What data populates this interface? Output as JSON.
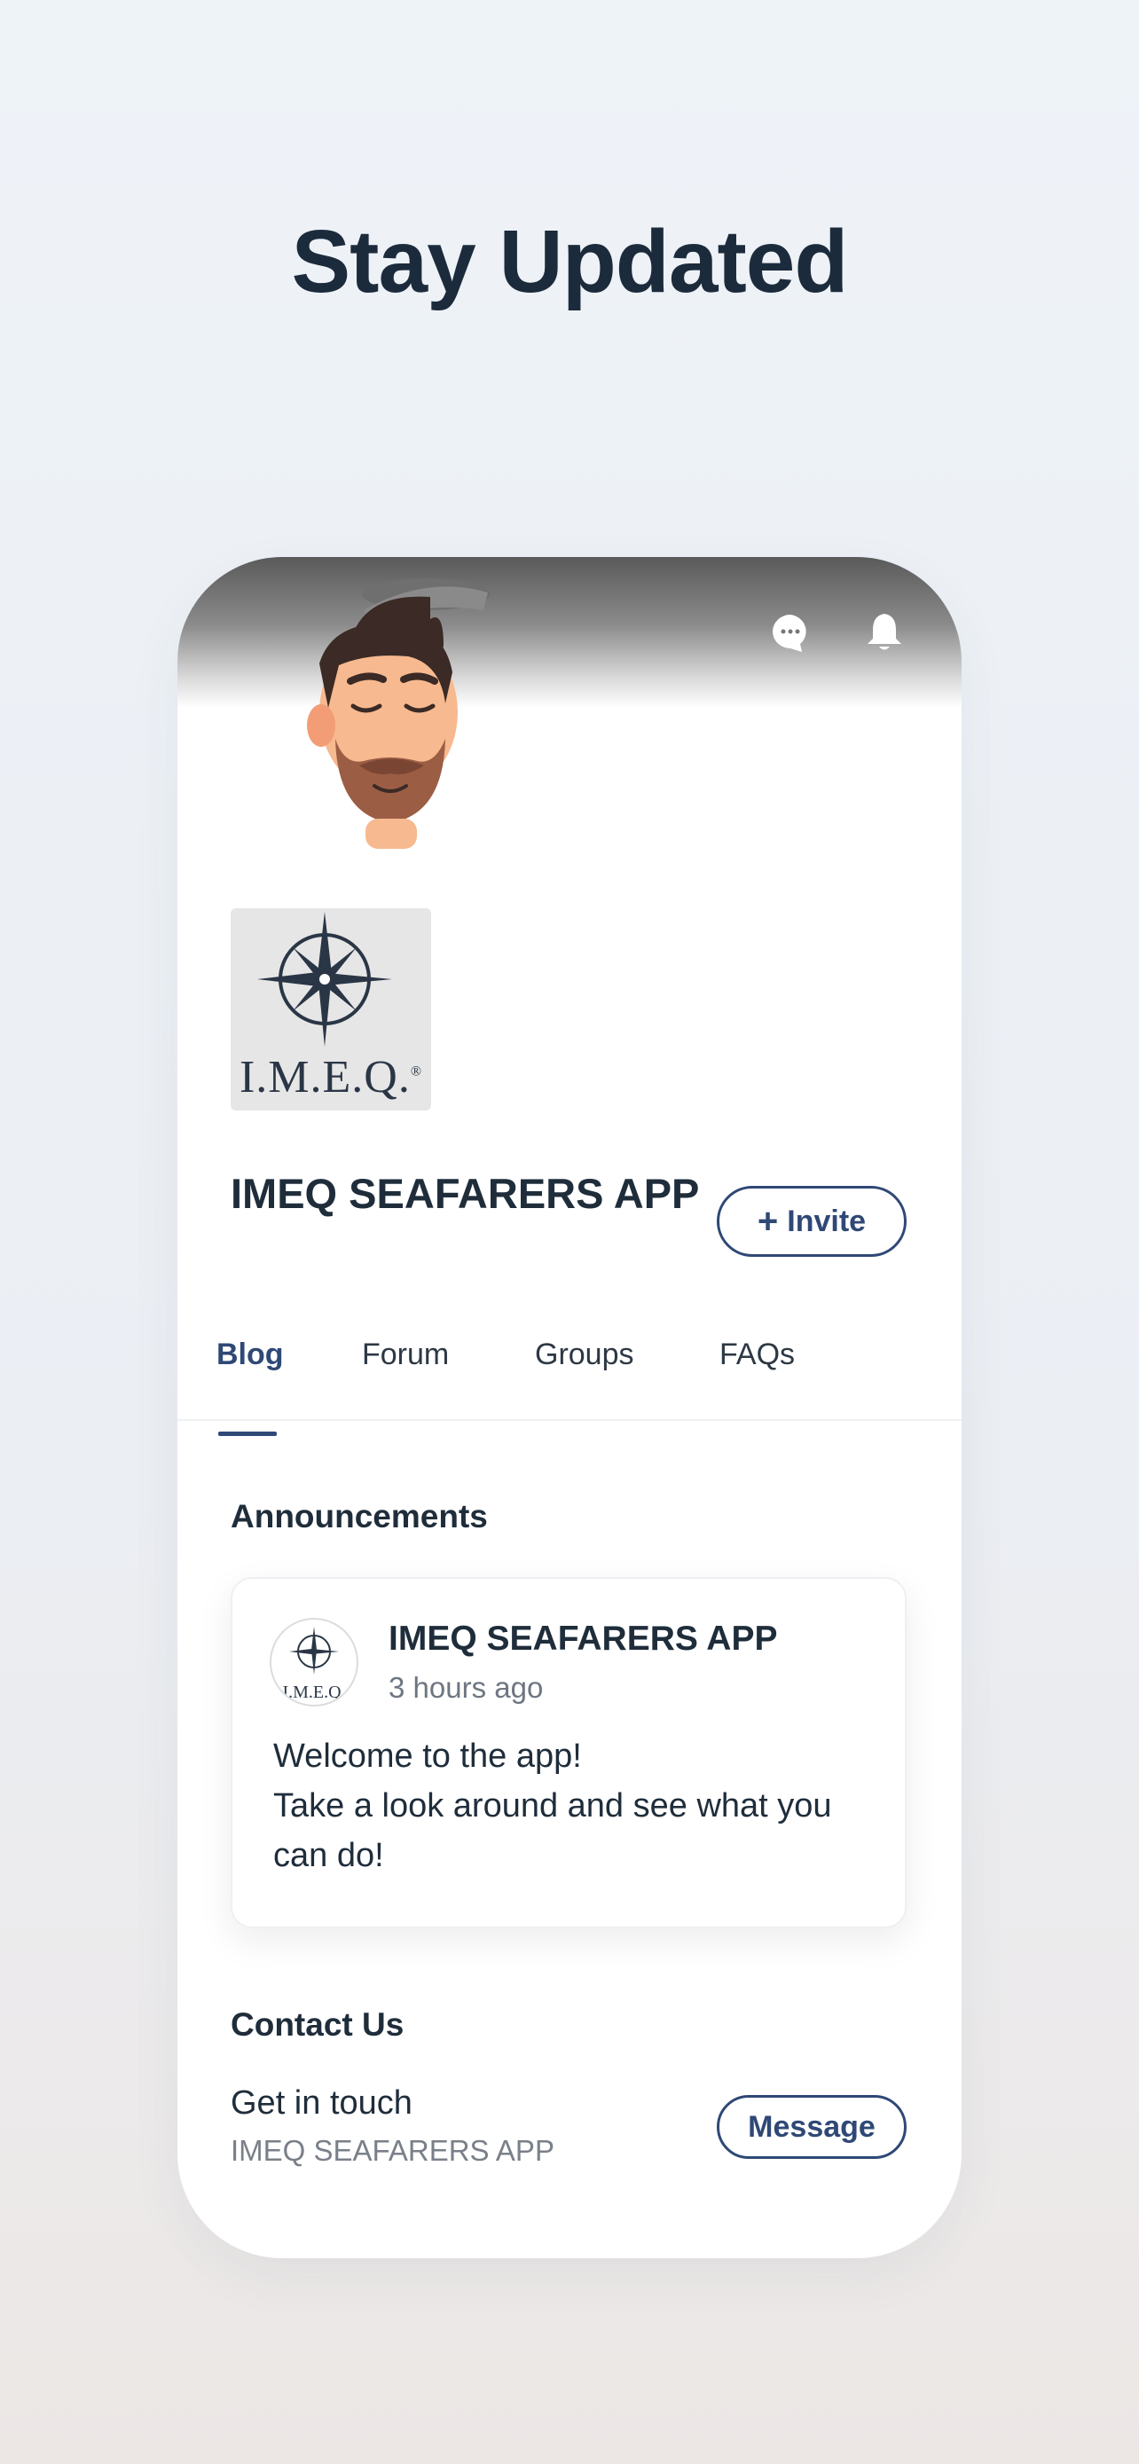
{
  "headline": "Stay Updated",
  "header_icons": {
    "chat": "chat-bubble-icon",
    "notifications": "bell-icon"
  },
  "cover": {
    "avatar": "sailor-illustration"
  },
  "logo": {
    "text": "I.M.E.Q.",
    "registered": "®"
  },
  "app": {
    "title": "IMEQ SEAFARERS APP",
    "invite_label": "Invite",
    "invite_icon": "plus-icon"
  },
  "tabs": [
    {
      "label": "Blog",
      "active": true
    },
    {
      "label": "Forum",
      "active": false
    },
    {
      "label": "Groups",
      "active": false
    },
    {
      "label": "FAQs",
      "active": false
    }
  ],
  "announcements": {
    "title": "Announcements",
    "post": {
      "author": "IMEQ SEAFARERS APP",
      "time": "3 hours ago",
      "avatar_text": "I.M.E.Q.",
      "line1": "Welcome to the app!",
      "line2": "Take a look around and see what you",
      "line3": "can do!"
    }
  },
  "contact": {
    "title": "Contact Us",
    "subtitle": "Get in touch",
    "name": "IMEQ SEAFARERS APP",
    "button_label": "Message"
  },
  "colors": {
    "accent": "#2f4876",
    "text": "#1f2d3b",
    "muted": "#7a8089",
    "headline": "#1c2b3c"
  }
}
